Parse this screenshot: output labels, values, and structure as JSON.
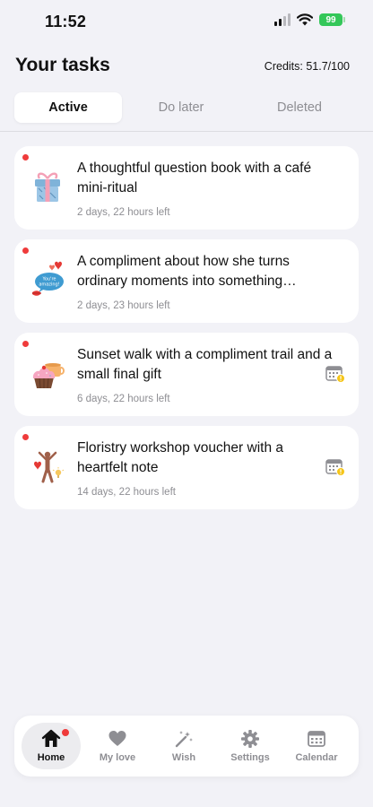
{
  "status_bar": {
    "time": "11:52",
    "battery": "99"
  },
  "header": {
    "title": "Your tasks",
    "credits": "Credits: 51.7/100"
  },
  "tabs": [
    {
      "label": "Active",
      "active": true
    },
    {
      "label": "Do later",
      "active": false
    },
    {
      "label": "Deleted",
      "active": false
    }
  ],
  "tasks": [
    {
      "title": "A thoughtful question book with a café mini-ritual",
      "time_left": "2 days, 22 hours left",
      "icon": "gift-box-icon",
      "unread": true,
      "calendar_warning": false
    },
    {
      "title": "A compliment about how she turns ordinary moments into something wonderful",
      "time_left": "2 days, 23 hours left",
      "icon": "compliment-bubble-icon",
      "icon_text": "You're amazing!",
      "unread": true,
      "calendar_warning": false
    },
    {
      "title": "Sunset walk with a compliment trail and a small final gift",
      "time_left": "6 days, 22 hours left",
      "icon": "cupcake-cup-icon",
      "unread": true,
      "calendar_warning": true
    },
    {
      "title": "Floristry workshop voucher with a heartfelt note",
      "time_left": "14 days, 22 hours left",
      "icon": "figure-heart-icon",
      "unread": true,
      "calendar_warning": true
    }
  ],
  "nav": [
    {
      "label": "Home",
      "icon": "home-icon",
      "active": true,
      "badge": true
    },
    {
      "label": "My love",
      "icon": "heart-icon",
      "active": false
    },
    {
      "label": "Wish",
      "icon": "magic-wand-icon",
      "active": false
    },
    {
      "label": "Settings",
      "icon": "gear-icon",
      "active": false
    },
    {
      "label": "Calendar",
      "icon": "calendar-icon",
      "active": false
    }
  ],
  "colors": {
    "accent_red": "#ef3b3b",
    "background": "#f2f2f7",
    "battery_green": "#34c759",
    "warning_yellow": "#f5c518"
  }
}
